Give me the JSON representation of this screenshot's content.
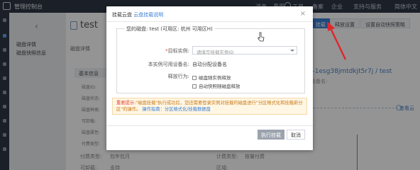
{
  "topbar": {
    "console": "管理控制台",
    "nav": [
      "消息",
      "费用",
      "工单",
      "备案",
      "企业",
      "支持与服务"
    ],
    "lang": "简体中文"
  },
  "sidebar": {
    "items": [
      "磁盘详情",
      "磁盘快照信息"
    ]
  },
  "main": {
    "disk_title": "test",
    "detail_tab": "磁盘详情",
    "info_header": "基本信息",
    "left_rows": [
      "磁盘ID:",
      "磁盘状态:",
      "磁盘种类:",
      "可卸载:",
      "磁盘属性:",
      "付费类型:"
    ],
    "tabs": [
      "挂载",
      "释放设置",
      "设置自动快照策略"
    ],
    "instance_link": "i-1esg38jmtdkjt5r7j / test",
    "instance_sub": "设备名:",
    "right_stat": "查看云",
    "bottom_labels": [
      "付费类型:",
      "包年包月",
      "计费类型:",
      "按量付费"
    ],
    "bottom_labels2": [
      "可卸载:",
      "支持",
      "区域:"
    ]
  },
  "modal": {
    "title_prefix": "挂载云盘",
    "title_link": "云盘挂载说明",
    "close": "×",
    "legend": "您的磁盘: test (可用区: 杭州 可用区H)",
    "target_label": "目标实例:",
    "target_placeholder": "请填写挂载实例ID",
    "device_label": "本实例可用设备名:",
    "device_value": "自动分配设备名",
    "release_label": "释放行为:",
    "cb1": "磁盘随实例释放",
    "cb2": "自动快照随磁盘释放",
    "warn_strong": "重要提示:",
    "warn_text": "\"磁盘挂载\"执行成功后，您还需要登录实例对挂载的磁盘进行\"分区格式化和挂载新分区\"的操作。",
    "warn_link": "操作指南：分区格式化/挂载数据盘",
    "confirm": "执行挂载",
    "cancel": "取消"
  },
  "colors": {
    "topbar": "#2f3746",
    "accent": "#3a7fd5",
    "warning_bg": "#fff6e3",
    "arrow": "#e0282e"
  }
}
